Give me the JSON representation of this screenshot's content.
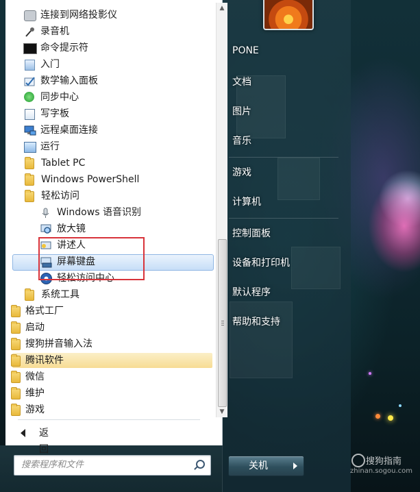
{
  "programs": {
    "items": [
      {
        "label": "连接到网络投影仪",
        "icon": "projector-icon"
      },
      {
        "label": "录音机",
        "icon": "microphone-icon"
      },
      {
        "label": "命令提示符",
        "icon": "command-prompt-icon"
      },
      {
        "label": "入门",
        "icon": "getting-started-icon"
      },
      {
        "label": "数学输入面板",
        "icon": "math-input-icon"
      },
      {
        "label": "同步中心",
        "icon": "sync-center-icon"
      },
      {
        "label": "写字板",
        "icon": "wordpad-icon"
      },
      {
        "label": "远程桌面连接",
        "icon": "remote-desktop-icon"
      },
      {
        "label": "运行",
        "icon": "run-icon"
      },
      {
        "label": "Tablet PC",
        "icon": "folder-icon"
      },
      {
        "label": "Windows PowerShell",
        "icon": "folder-icon"
      },
      {
        "label": "轻松访问",
        "icon": "folder-icon"
      },
      {
        "label": "Windows 语音识别",
        "icon": "speech-recognition-icon"
      },
      {
        "label": "放大镜",
        "icon": "magnifier-icon"
      },
      {
        "label": "讲述人",
        "icon": "narrator-icon"
      },
      {
        "label": "屏幕键盘",
        "icon": "on-screen-keyboard-icon"
      },
      {
        "label": "轻松访问中心",
        "icon": "ease-of-access-icon"
      },
      {
        "label": "系统工具",
        "icon": "folder-icon"
      },
      {
        "label": "格式工厂",
        "icon": "folder-icon"
      },
      {
        "label": "启动",
        "icon": "folder-icon"
      },
      {
        "label": "搜狗拼音输入法",
        "icon": "folder-icon"
      },
      {
        "label": "腾讯软件",
        "icon": "folder-icon"
      },
      {
        "label": "微信",
        "icon": "folder-icon"
      },
      {
        "label": "维护",
        "icon": "folder-icon"
      },
      {
        "label": "游戏",
        "icon": "folder-icon"
      }
    ],
    "back_label": "返回"
  },
  "search": {
    "placeholder": "搜索程序和文件"
  },
  "right_links": [
    {
      "label": "PONE"
    },
    {
      "label": "文档"
    },
    {
      "label": "图片"
    },
    {
      "label": "音乐"
    },
    {
      "label": "游戏"
    },
    {
      "label": "计算机"
    },
    {
      "label": "控制面板"
    },
    {
      "label": "设备和打印机"
    },
    {
      "label": "默认程序"
    },
    {
      "label": "帮助和支持"
    }
  ],
  "shutdown": {
    "label": "关机"
  },
  "watermark": {
    "brand": "搜狗指南",
    "site": "zhinan.sogou.com"
  },
  "colors": {
    "selection": "#c7def7",
    "highlight_new": "#f7dc94",
    "annotation_box": "#d8333a"
  }
}
